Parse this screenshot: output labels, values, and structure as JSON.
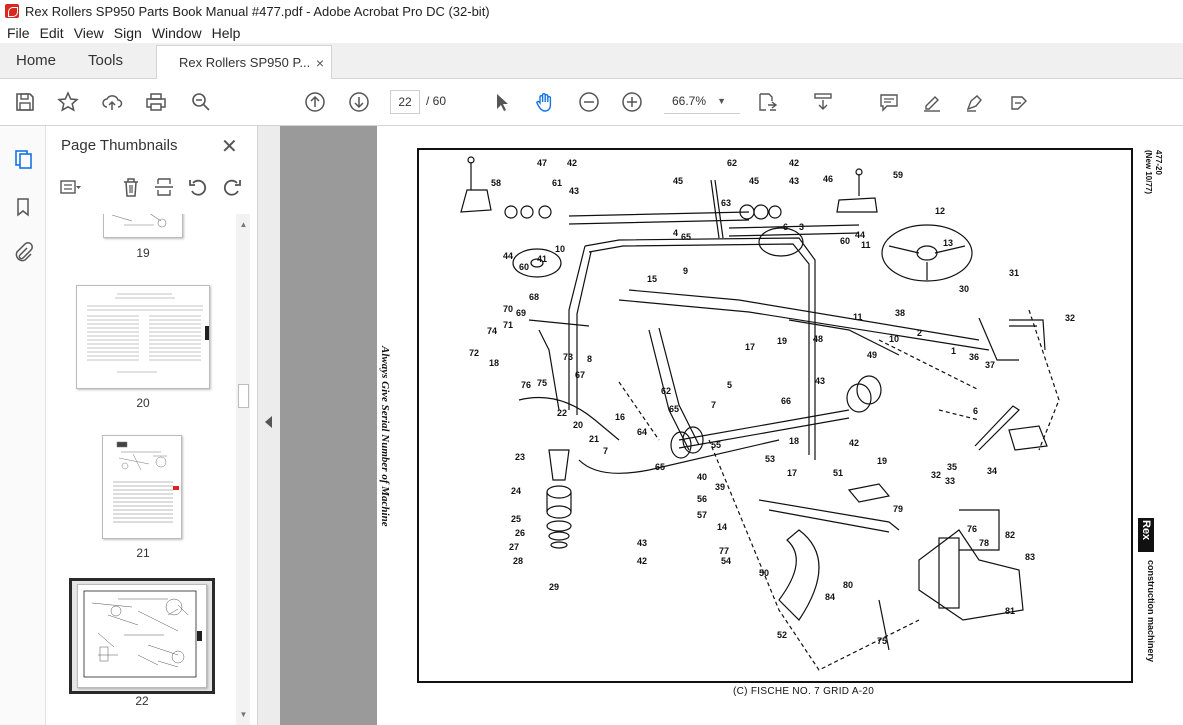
{
  "window": {
    "title": "Rex Rollers SP950 Parts Book Manual #477.pdf - Adobe Acrobat Pro DC (32-bit)"
  },
  "menu": [
    "File",
    "Edit",
    "View",
    "Sign",
    "Window",
    "Help"
  ],
  "tabs": {
    "home": "Home",
    "tools": "Tools",
    "document": "Rex Rollers SP950 P...",
    "close": "×"
  },
  "toolbar": {
    "current_page": "22",
    "page_total": "/ 60",
    "zoom": "66.7%",
    "icons": [
      "save-icon",
      "star-icon",
      "upload-icon",
      "print-icon",
      "zoom-search-icon",
      "page-up-icon",
      "page-down-icon",
      "select-arrow-icon",
      "hand-icon",
      "zoom-out-icon",
      "zoom-in-icon",
      "fit-page-icon",
      "scroll-mode-icon",
      "comment-icon",
      "highlight-icon",
      "sign-icon",
      "fill-sign-icon"
    ]
  },
  "panel": {
    "title": "Page Thumbnails",
    "close": "✕",
    "thumbnails": [
      {
        "label": "19"
      },
      {
        "label": "20"
      },
      {
        "label": "21"
      },
      {
        "label": "22",
        "selected": true
      }
    ]
  },
  "document": {
    "side_left": "Always Give Serial Number of Machine",
    "side_right_line1": "477-20",
    "side_right_line2": "(New 10/77)",
    "brand": "Rex",
    "brand_sub": "construction machinery",
    "caption": "(C)  FISCHE  NO. 7  GRID  A-20",
    "part_callouts": [
      "47",
      "42",
      "61",
      "43",
      "58",
      "44",
      "60",
      "41",
      "10",
      "45",
      "62",
      "63",
      "4",
      "65",
      "45",
      "42",
      "43",
      "46",
      "59",
      "60",
      "44",
      "12",
      "13",
      "11",
      "3",
      "6",
      "15",
      "9",
      "31",
      "30",
      "32",
      "70",
      "69",
      "74",
      "71",
      "68",
      "72",
      "18",
      "73",
      "8",
      "67",
      "76",
      "75",
      "7",
      "38",
      "10",
      "11",
      "2",
      "1",
      "36",
      "37",
      "48",
      "49",
      "17",
      "19",
      "5",
      "43",
      "42",
      "66",
      "62",
      "65",
      "22",
      "20",
      "16",
      "64",
      "21",
      "7",
      "23",
      "24",
      "25",
      "26",
      "27",
      "28",
      "29",
      "55",
      "18",
      "65",
      "40",
      "39",
      "56",
      "57",
      "14",
      "53",
      "17",
      "51",
      "19",
      "77",
      "54",
      "50",
      "84",
      "52",
      "79",
      "32",
      "35",
      "33",
      "34",
      "6",
      "76",
      "78",
      "82",
      "83",
      "80",
      "75",
      "81"
    ]
  },
  "colors": {
    "accent": "#1473e6",
    "doc_background": "#9a9a9a"
  }
}
